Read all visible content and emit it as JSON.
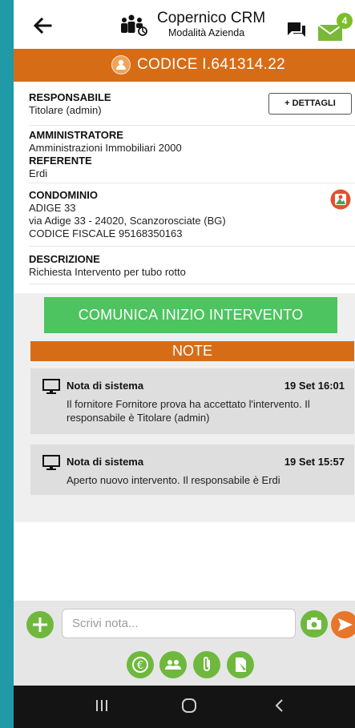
{
  "header": {
    "app_title": "Copernico CRM",
    "app_subtitle": "Modalità Azienda",
    "mail_badge": "4"
  },
  "code_bar": {
    "code": "CODICE I.641314.22"
  },
  "responsabile": {
    "label": "RESPONSABILE",
    "value": "Titolare (admin)",
    "details_button": "+ DETTAGLI"
  },
  "amministratore": {
    "label": "AMMINISTRATORE",
    "value": "Amministrazioni Immobiliari 2000"
  },
  "referente": {
    "label": "REFERENTE",
    "value": "Erdi"
  },
  "condominio": {
    "label": "CONDOMINIO",
    "name": "ADIGE 33",
    "address": "via Adige 33 - 24020, Scanzorosciate (BG)",
    "fiscal_code": "CODICE FISCALE 95168350163"
  },
  "descrizione": {
    "label": "DESCRIZIONE",
    "value": "Richiesta Intervento per tubo rotto"
  },
  "action_button": "COMUNICA INIZIO INTERVENTO",
  "notes_header": "NOTE",
  "notes": [
    {
      "title": "Nota di sistema",
      "date": "19 Set 16:01",
      "text": "Il fornitore Fornitore prova ha accettato l'intervento. Il responsabile è Titolare (admin)"
    },
    {
      "title": "Nota di sistema",
      "date": "19 Set 15:57",
      "text": "Aperto nuovo intervento. Il responsabile è Erdi"
    }
  ],
  "composer": {
    "placeholder": "Scrivi nota..."
  },
  "colors": {
    "orange": "#d76c17",
    "green": "#4dc45f",
    "teal_frame": "#1f9aa6"
  }
}
